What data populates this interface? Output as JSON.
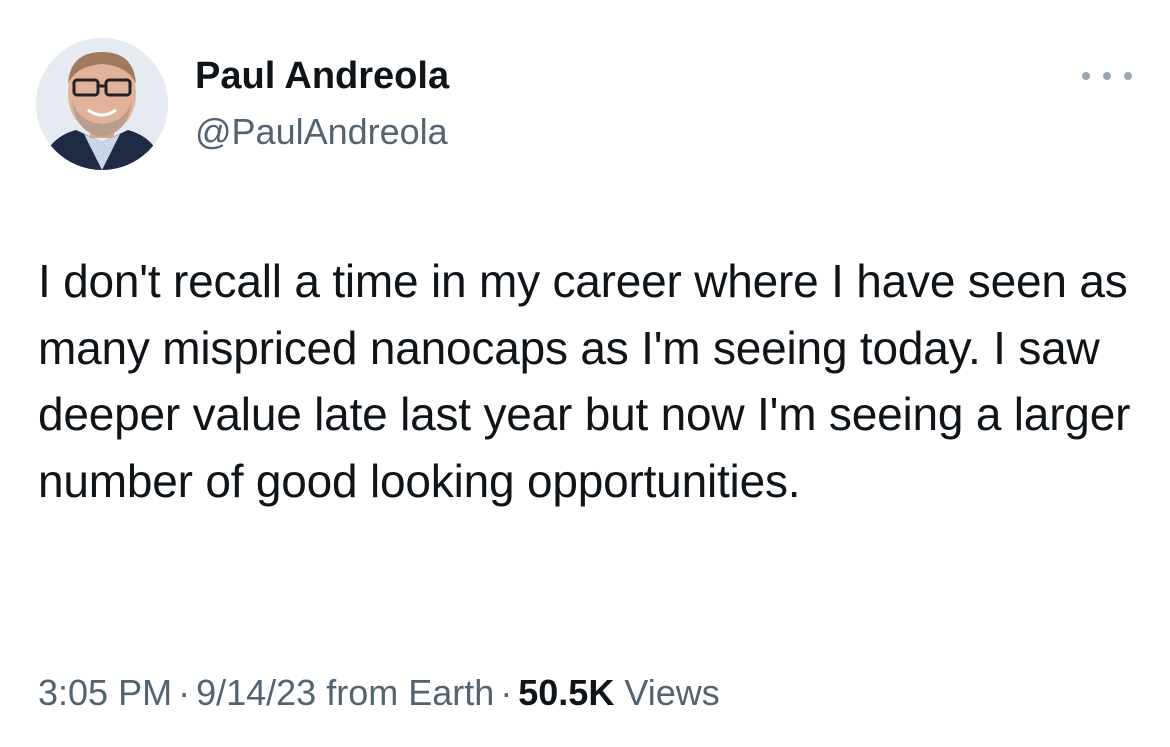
{
  "author": {
    "name": "Paul Andreola",
    "handle": "@PaulAndreola"
  },
  "tweet": {
    "text": "I don't recall a time in my career where I have seen as many mispriced nanocaps as I'm seeing today. I saw deeper value late last year but now I'm seeing a larger number of good looking opportunities."
  },
  "meta": {
    "time": "3:05 PM",
    "date": "9/14/23",
    "source": "from Earth",
    "separator": "·",
    "views_count": "50.5K",
    "views_label": "Views"
  },
  "icons": {
    "more": "more-options-icon"
  },
  "colors": {
    "text": "#0f1419",
    "secondary": "#536471",
    "background": "#ffffff"
  }
}
